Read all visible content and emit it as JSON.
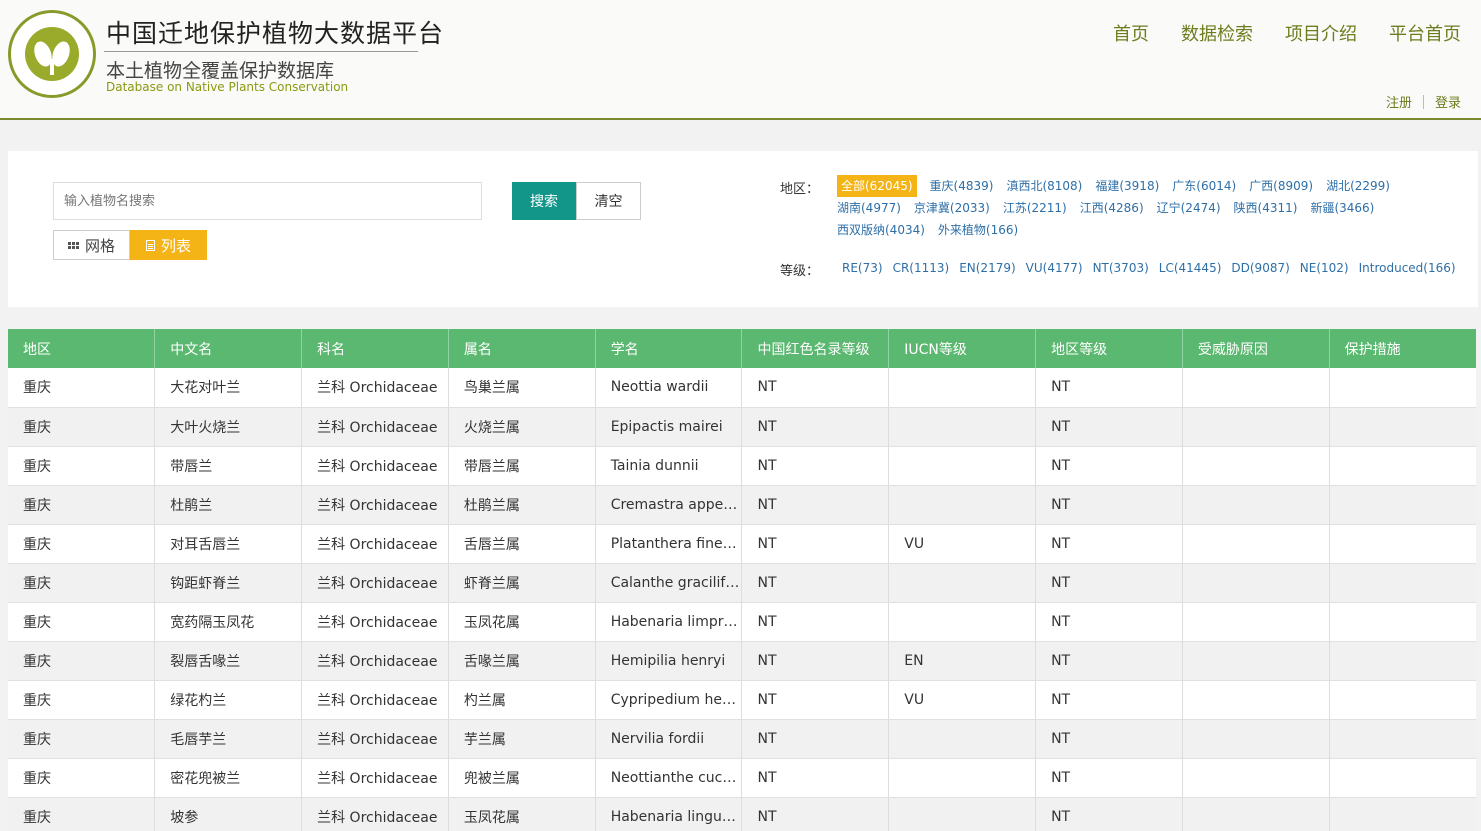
{
  "header": {
    "title": "中国迁地保护植物大数据平台",
    "subtitle": "本土植物全覆盖保护数据库",
    "subtitle_en": "Database on Native Plants Conservation",
    "nav": [
      "首页",
      "数据检索",
      "项目介绍",
      "平台首页"
    ],
    "register": "注册",
    "login": "登录"
  },
  "search": {
    "placeholder": "输入植物名搜索",
    "search_label": "搜索",
    "clear_label": "清空",
    "view_grid": "网格",
    "view_list": "列表"
  },
  "filters": {
    "region_label": "地区：",
    "regions": [
      "全部(62045)",
      "重庆(4839)",
      "滇西北(8108)",
      "福建(3918)",
      "广东(6014)",
      "广西(8909)",
      "湖北(2299)",
      "湖南(4977)",
      "京津冀(2033)",
      "江苏(2211)",
      "江西(4286)",
      "辽宁(2474)",
      "陕西(4311)",
      "新疆(3466)",
      "西双版纳(4034)",
      "外来植物(166)"
    ],
    "level_label": "等级：",
    "levels": [
      "RE(73)",
      "CR(1113)",
      "EN(2179)",
      "VU(4177)",
      "NT(3703)",
      "LC(41445)",
      "DD(9087)",
      "NE(102)",
      "Introduced(166)"
    ]
  },
  "table": {
    "columns": [
      "地区",
      "中文名",
      "科名",
      "属名",
      "学名",
      "中国红色名录等级",
      "IUCN等级",
      "地区等级",
      "受威胁原因",
      "保护措施"
    ],
    "rows": [
      [
        "重庆",
        "大花对叶兰",
        "兰科 Orchidaceae",
        "鸟巢兰属",
        "Neottia wardii",
        "NT",
        "",
        "NT",
        "",
        ""
      ],
      [
        "重庆",
        "大叶火烧兰",
        "兰科 Orchidaceae",
        "火烧兰属",
        "Epipactis mairei",
        "NT",
        "",
        "NT",
        "",
        ""
      ],
      [
        "重庆",
        "带唇兰",
        "兰科 Orchidaceae",
        "带唇兰属",
        "Tainia dunnii",
        "NT",
        "",
        "NT",
        "",
        ""
      ],
      [
        "重庆",
        "杜鹃兰",
        "兰科 Orchidaceae",
        "杜鹃兰属",
        "Cremastra appe…",
        "NT",
        "",
        "NT",
        "",
        ""
      ],
      [
        "重庆",
        "对耳舌唇兰",
        "兰科 Orchidaceae",
        "舌唇兰属",
        "Platanthera fine…",
        "NT",
        "VU",
        "NT",
        "",
        ""
      ],
      [
        "重庆",
        "钩距虾脊兰",
        "兰科 Orchidaceae",
        "虾脊兰属",
        "Calanthe gracilif…",
        "NT",
        "",
        "NT",
        "",
        ""
      ],
      [
        "重庆",
        "宽药隔玉凤花",
        "兰科 Orchidaceae",
        "玉凤花属",
        "Habenaria limpr…",
        "NT",
        "",
        "NT",
        "",
        ""
      ],
      [
        "重庆",
        "裂唇舌喙兰",
        "兰科 Orchidaceae",
        "舌喙兰属",
        "Hemipilia henryi",
        "NT",
        "EN",
        "NT",
        "",
        ""
      ],
      [
        "重庆",
        "绿花杓兰",
        "兰科 Orchidaceae",
        "杓兰属",
        "Cypripedium he…",
        "NT",
        "VU",
        "NT",
        "",
        ""
      ],
      [
        "重庆",
        "毛唇芋兰",
        "兰科 Orchidaceae",
        "芋兰属",
        "Nervilia fordii",
        "NT",
        "",
        "NT",
        "",
        ""
      ],
      [
        "重庆",
        "密花兜被兰",
        "兰科 Orchidaceae",
        "兜被兰属",
        "Neottianthe cuc…",
        "NT",
        "",
        "NT",
        "",
        ""
      ],
      [
        "重庆",
        "坡参",
        "兰科 Orchidaceae",
        "玉凤花属",
        "Habenaria lingu…",
        "NT",
        "",
        "NT",
        "",
        ""
      ]
    ]
  }
}
